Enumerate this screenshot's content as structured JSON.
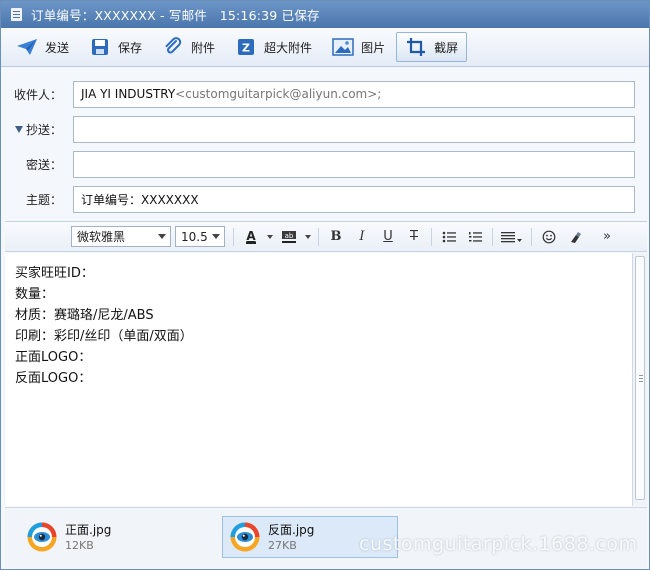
{
  "window": {
    "title": "订单编号：XXXXXXX - 写邮件　15:16:39 已保存"
  },
  "toolbar": {
    "send": "发送",
    "save": "保存",
    "attach": "附件",
    "large_attach": "超大附件",
    "image": "图片",
    "screenshot": "截屏"
  },
  "fields": {
    "to_label": "收件人：",
    "to_name": "JIA YI INDUSTRY",
    "to_addr": "<customguitarpick@aliyun.com>;",
    "cc_label": "抄送：",
    "cc_value": "",
    "bcc_label": "密送：",
    "bcc_value": "",
    "subject_label": "主题：",
    "subject_value": "订单编号：XXXXXXX"
  },
  "format": {
    "font_family": "微软雅黑",
    "font_size": "10.5",
    "bold": "B",
    "italic": "I",
    "underline": "U",
    "strike": "T",
    "more": "»"
  },
  "body": {
    "lines": [
      "买家旺旺ID：",
      "数量：",
      "材质：赛璐珞/尼龙/ABS",
      "印刷：彩印/丝印（单面/双面）",
      "正面LOGO：",
      "反面LOGO："
    ]
  },
  "attachments": [
    {
      "name": "正面.jpg",
      "size": "12KB"
    },
    {
      "name": "反面.jpg",
      "size": "27KB"
    }
  ],
  "watermark": "customguitarpick.1688.com",
  "colors": {
    "titlebar": "#4a76ad",
    "accent": "#2f76d2",
    "selection": "#dbe9f8"
  }
}
